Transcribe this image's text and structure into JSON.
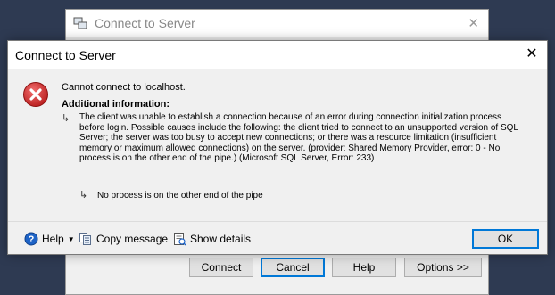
{
  "background_window": {
    "title": "Connect to Server",
    "close_glyph": "✕",
    "buttons": {
      "connect": "Connect",
      "cancel": "Cancel",
      "help": "Help",
      "options": "Options >>"
    }
  },
  "dialog": {
    "title": "Connect to Server",
    "close_glyph": "✕",
    "icon": "error-icon",
    "main_message": "Cannot connect to localhost.",
    "additional_info_label": "Additional information:",
    "detail_message": "The client was unable to establish a connection because of an error during connection initialization process before login. Possible causes include the following:  the client tried to connect to an unsupported version of SQL Server; the server was too busy to accept new connections; or there was a resource limitation (insufficient memory or maximum allowed connections) on the server. (provider: Shared Memory Provider, error: 0 - No process is on the other end of the pipe.) (Microsoft SQL Server, Error: 233)",
    "inner_message": "No process is on the other end of the pipe",
    "arrow_glyph": "↳",
    "footer": {
      "help": "Help",
      "copy_message": "Copy message",
      "show_details": "Show details",
      "ok": "OK"
    }
  },
  "colors": {
    "error_red": "#d32f2f",
    "accent": "#0078d7",
    "desktop": "#2e3a52"
  }
}
